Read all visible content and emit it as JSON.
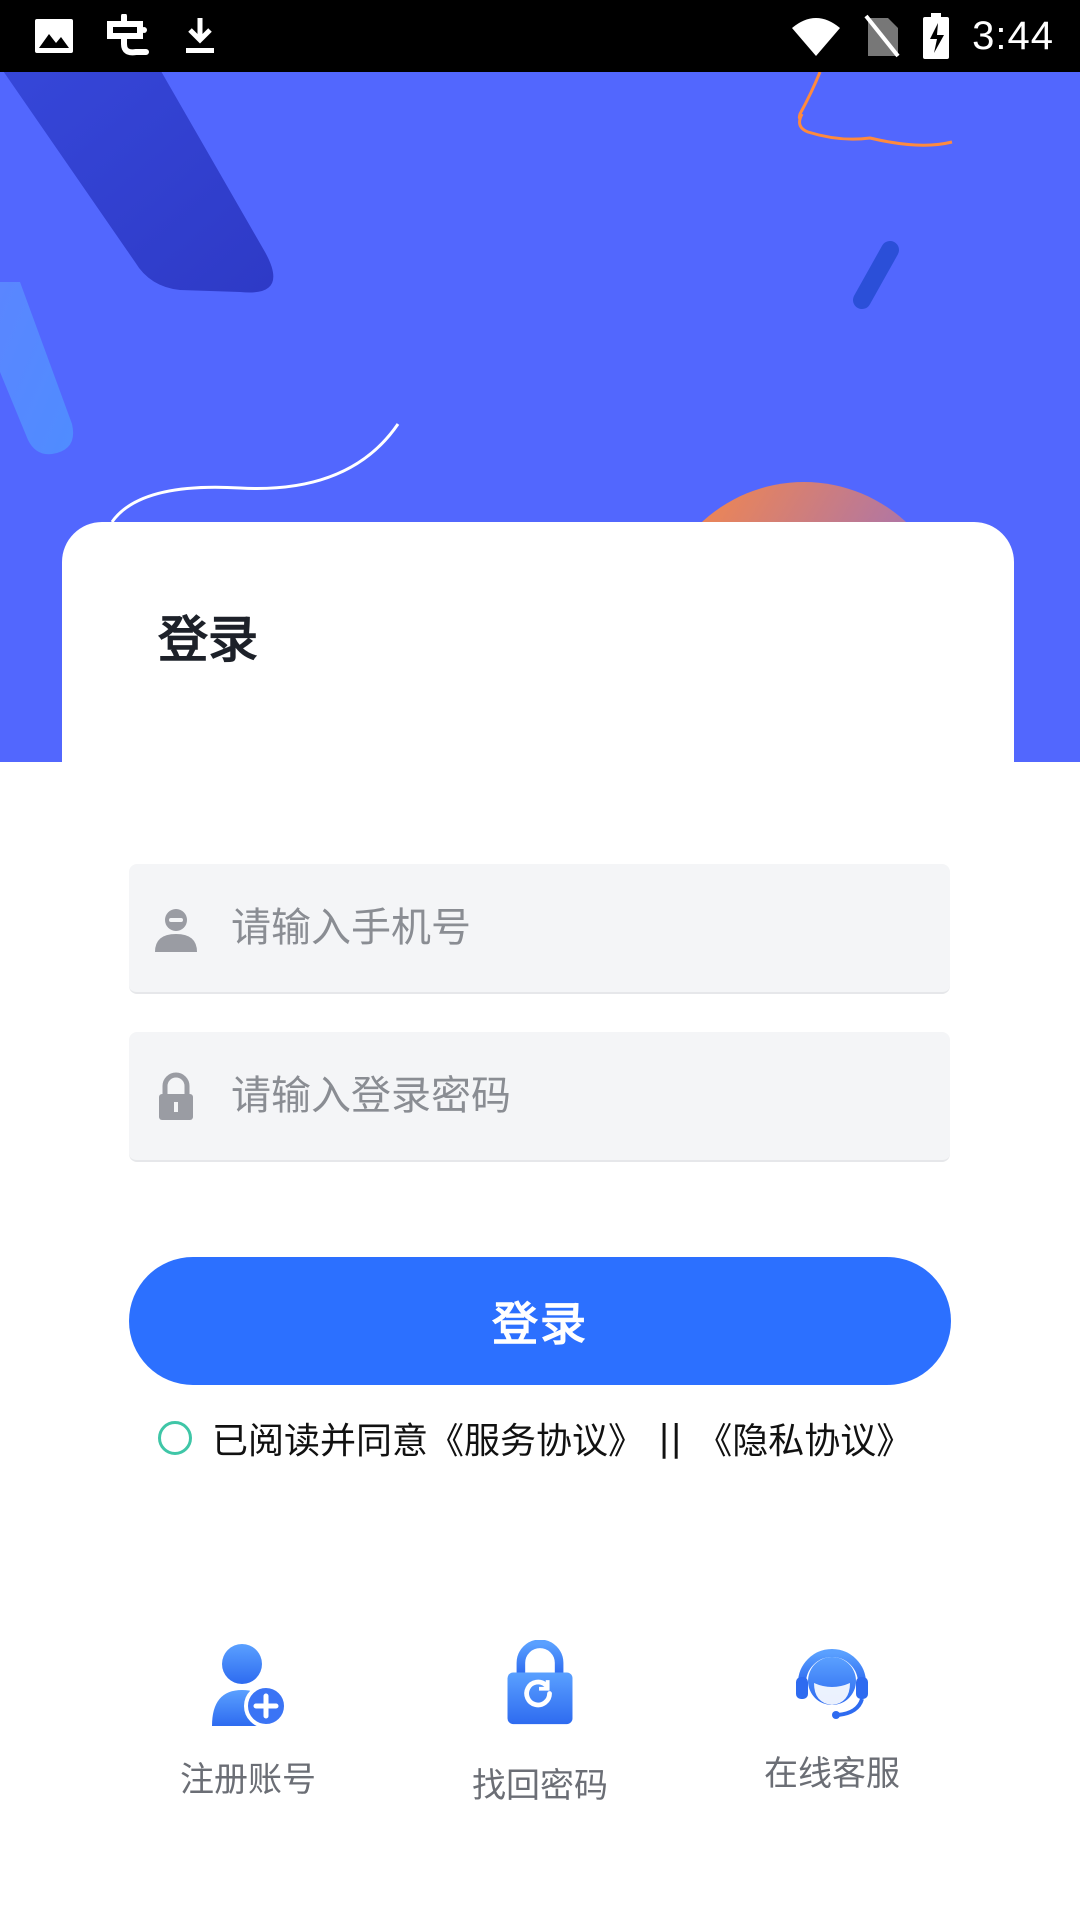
{
  "status_bar": {
    "time": "3:44",
    "left_icons": [
      "image-icon",
      "app-icon",
      "download-icon"
    ],
    "right_icons": [
      "wifi-icon",
      "no-sim-icon",
      "battery-charging-icon"
    ]
  },
  "page": {
    "title": "登录"
  },
  "form": {
    "phone_placeholder": "请输入手机号",
    "password_placeholder": "请输入登录密码",
    "login_button": "登录"
  },
  "agreement": {
    "prefix": "已阅读并同意",
    "service_link": "《服务协议》",
    "separator": "||",
    "privacy_link": "《隐私协议》"
  },
  "shortcuts": [
    {
      "label": "注册账号",
      "icon": "add-user-icon"
    },
    {
      "label": "找回密码",
      "icon": "lock-refresh-icon"
    },
    {
      "label": "在线客服",
      "icon": "customer-service-icon"
    }
  ],
  "colors": {
    "hero": "#5267fe",
    "primary": "#2c70ff",
    "radio": "#3fc6a7",
    "field_bg": "#f4f5f7"
  }
}
